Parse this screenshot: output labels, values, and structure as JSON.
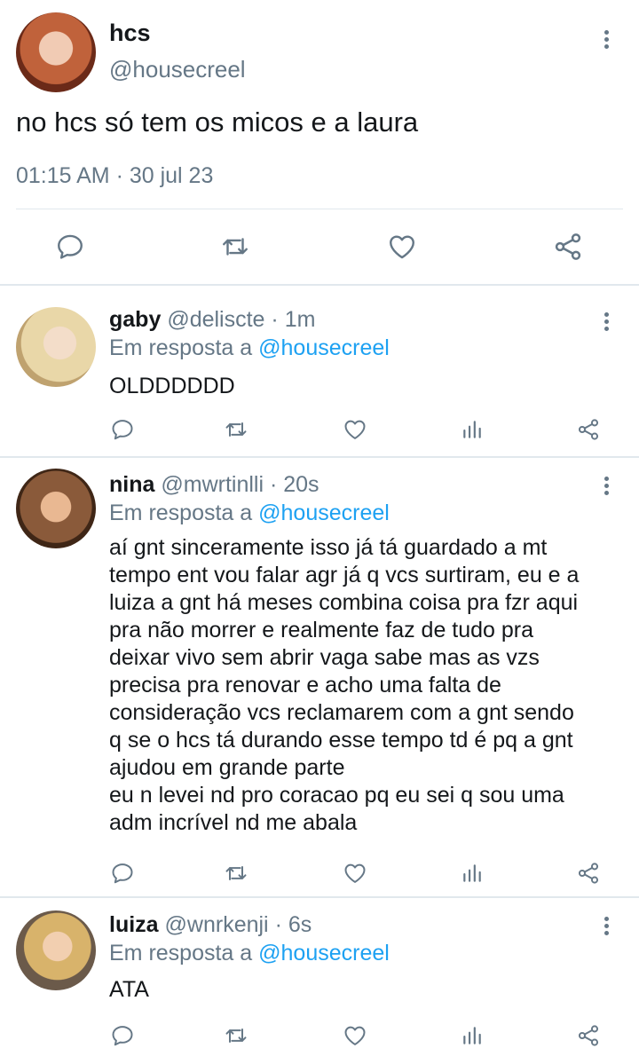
{
  "main_tweet": {
    "name": "hcs",
    "handle": "@housecreel",
    "text": "no hcs só tem os micos e a laura",
    "timestamp": "01:15 AM · 30 jul 23",
    "icons": [
      "reply-icon",
      "retweet-icon",
      "like-icon",
      "share-icon",
      "more-icon"
    ]
  },
  "replies": [
    {
      "name": "gaby",
      "handle": "@deliscte",
      "time": "· 1m",
      "reply_prefix": "Em resposta a",
      "reply_mention": "@housecreel",
      "lines": [
        "OLDDDDDD"
      ]
    },
    {
      "name": "nina",
      "handle": "@mwrtinlli",
      "time": "· 20s",
      "reply_prefix": "Em resposta a",
      "reply_mention": "@housecreel",
      "lines": [
        "aí gnt sinceramente isso já tá guardado a mt",
        "tempo ent vou falar agr já q vcs surtiram, eu e a",
        "luiza a gnt há meses combina coisa pra fzr aqui",
        "pra não morrer e realmente faz de tudo pra",
        "deixar vivo sem abrir vaga sabe mas as vzs",
        "precisa pra renovar e acho uma falta de",
        "consideração vcs reclamarem com a gnt sendo",
        "q se o hcs tá durando esse tempo td é pq a gnt",
        "ajudou em grande parte",
        "eu n levei nd pro coracao pq eu sei q sou uma",
        "adm incrível nd me abala"
      ]
    },
    {
      "name": "luiza",
      "handle": "@wnrkenji",
      "time": "· 6s",
      "reply_prefix": "Em resposta a",
      "reply_mention": "@housecreel",
      "lines": [
        "ATA"
      ]
    }
  ],
  "colors": {
    "text": "#14171a",
    "secondary": "#657786",
    "accent": "#1da1f2",
    "divider": "#e1e8ed"
  }
}
